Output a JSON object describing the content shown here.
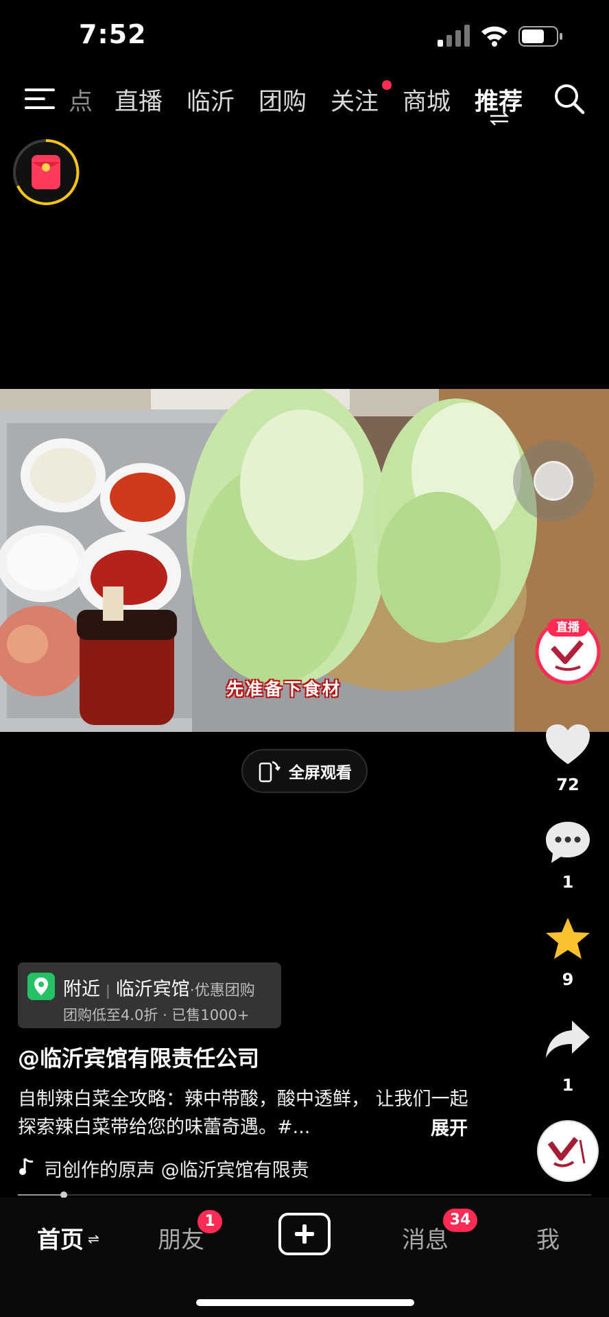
{
  "status_bar": {
    "time": "7:52"
  },
  "top_nav": {
    "tabs": [
      {
        "label": "点",
        "active": false
      },
      {
        "label": "直播",
        "active": false
      },
      {
        "label": "临沂",
        "active": false
      },
      {
        "label": "团购",
        "active": false
      },
      {
        "label": "关注",
        "active": false,
        "dot": true
      },
      {
        "label": "商城",
        "active": false
      },
      {
        "label": "推荐",
        "active": true
      }
    ]
  },
  "video": {
    "subtitle": "先准备下食材"
  },
  "fullscreen_button": {
    "label": "全屏观看"
  },
  "right_rail": {
    "live_badge": "直播",
    "like_count": "72",
    "comment_count": "1",
    "favorite_count": "9",
    "share_count": "1"
  },
  "poi": {
    "label": "附近",
    "name": "临沂宾馆",
    "tag": "·优惠团购",
    "detail": "团购低至4.0折 · 已售1000+"
  },
  "post": {
    "author": "@临沂宾馆有限责任公司",
    "description": "自制辣白菜全攻略：辣中带酸，酸中透鲜， 让我们一起探索辣白菜带给您的味蕾奇遇。#...",
    "expand_label": "展开",
    "music": "司创作的原声    @临沂宾馆有限责",
    "progress": 0.08
  },
  "bottom_nav": {
    "home": "首页",
    "friends": "朋友",
    "friends_badge": "1",
    "messages": "消息",
    "messages_badge": "34",
    "me": "我"
  },
  "colors": {
    "accent": "#fe2c55",
    "star": "#fbc02d",
    "location_pin": "#25c265"
  }
}
